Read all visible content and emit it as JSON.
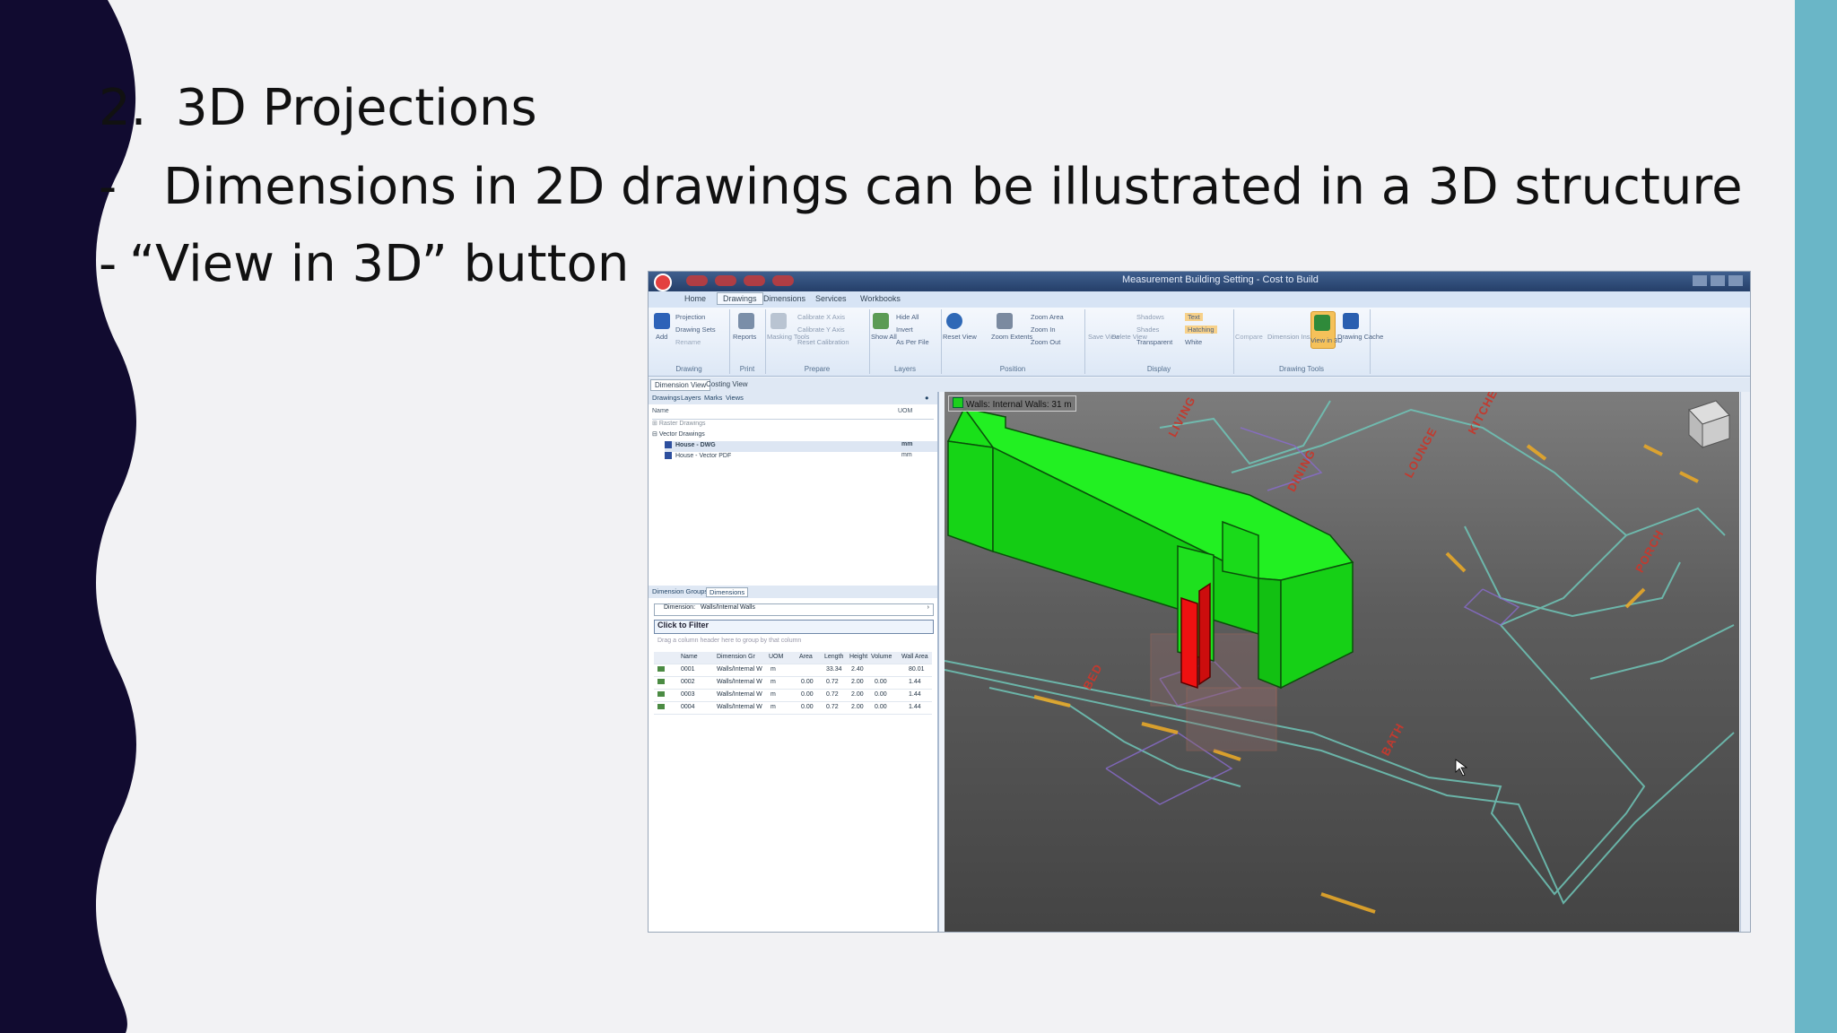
{
  "slide": {
    "line1": {
      "marker": "2.",
      "text": "3D Projections"
    },
    "line2": {
      "marker": "-",
      "text": "Dimensions in 2D drawings can be illustrated in a 3D structure"
    },
    "line3": {
      "marker": "-",
      "text": "“View in 3D” button"
    }
  },
  "app": {
    "title": "Measurement Building Setting - Cost to Build",
    "ribbon_tabs": [
      "Home",
      "Drawings",
      "Dimensions",
      "Services",
      "Workbooks"
    ],
    "active_tab": "Drawings",
    "groups": [
      "Drawing",
      "Print",
      "Prepare",
      "Layers",
      "Position",
      "Display",
      "Drawing Tools"
    ],
    "buttons": {
      "add": "Add",
      "projection": "Projection",
      "drawing_sets": "Drawing Sets",
      "rename": "Rename",
      "reports": "Reports",
      "masking_tools": "Masking Tools",
      "calibrate_x": "Calibrate X Axis",
      "calibrate_y": "Calibrate Y Axis",
      "reset_calibration": "Reset Calibration",
      "show_all": "Show All",
      "hide_all": "Hide All",
      "invert": "Invert",
      "as_per_file": "As Per File",
      "reset_view": "Reset View",
      "zoom_extents": "Zoom Extents",
      "zoom_area": "Zoom Area",
      "zoom_in": "Zoom In",
      "zoom_out": "Zoom Out",
      "save_view": "Save View",
      "delete_view": "Delete View",
      "shadows": "Shadows",
      "shades": "Shades",
      "transparent": "Transparent",
      "text": "Text",
      "hatching": "Hatching",
      "white": "White",
      "compare": "Compare",
      "dimension_inspector": "Dimension Inspector",
      "view_in_3d": "View in 3D",
      "drawing_cache": "Drawing Cache"
    },
    "doc_tabs": [
      "Dimension View",
      "Costing View"
    ],
    "panel_tabs": [
      "Drawings",
      "Layers",
      "Marks",
      "Views"
    ],
    "tree": {
      "col_name": "Name",
      "col_uom": "UOM",
      "raster_drawings": "Raster Drawings",
      "vector_drawings": "Vector Drawings",
      "items": [
        {
          "name": "House - DWG",
          "uom": "mm"
        },
        {
          "name": "House - Vector PDF",
          "uom": "mm"
        }
      ]
    },
    "sub_tabs": [
      "Dimension Groups",
      "Dimensions"
    ],
    "filter": {
      "label": "Dimension:",
      "value": "Walls/Internal Walls"
    },
    "click_to_filter": "Click to Filter",
    "group_hint": "Drag a column header here to group by that column",
    "grid": {
      "headers": [
        "Name",
        "Dimension Gr",
        "UOM",
        "Area",
        "Length",
        "Height",
        "Volume",
        "Wall Area"
      ],
      "rows": [
        [
          "0001",
          "Walls/Internal W",
          "m",
          "",
          "33.34",
          "2.40",
          "",
          "80.01"
        ],
        [
          "0002",
          "Walls/Internal W",
          "m",
          "0.00",
          "0.72",
          "2.00",
          "0.00",
          "1.44"
        ],
        [
          "0003",
          "Walls/Internal W",
          "m",
          "0.00",
          "0.72",
          "2.00",
          "0.00",
          "1.44"
        ],
        [
          "0004",
          "Walls/Internal W",
          "m",
          "0.00",
          "0.72",
          "2.00",
          "0.00",
          "1.44"
        ]
      ]
    },
    "viewport": {
      "wall_label": "Walls: Internal Walls: 31 m",
      "rooms": [
        "LIVING",
        "LOUNGE",
        "DINING",
        "KITCHEN",
        "BED",
        "PORCH",
        "BATH"
      ]
    },
    "colors": {
      "wall_green": "#1dd01d",
      "door_red": "#ee1111",
      "plan_line": "#6fc6b8",
      "room_text": "#c23a2f",
      "accent_teal": "#6ab6c7",
      "slide_navy": "#110b30"
    }
  }
}
